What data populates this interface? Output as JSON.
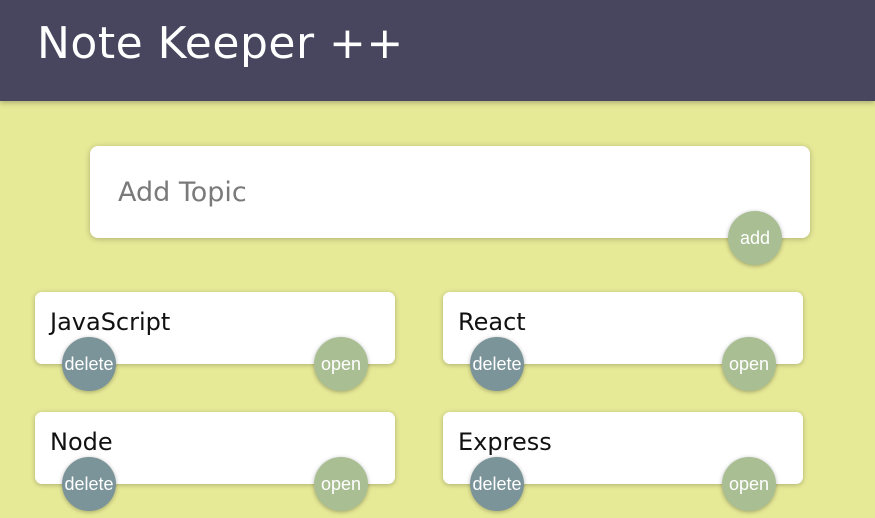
{
  "header": {
    "title": "Note Keeper ++"
  },
  "add_topic": {
    "placeholder": "Add Topic",
    "value": "",
    "add_label": "add"
  },
  "topics": [
    {
      "name": "JavaScript",
      "delete_label": "delete",
      "open_label": "open"
    },
    {
      "name": "React",
      "delete_label": "delete",
      "open_label": "open"
    },
    {
      "name": "Node",
      "delete_label": "delete",
      "open_label": "open"
    },
    {
      "name": "Express",
      "delete_label": "delete",
      "open_label": "open"
    }
  ],
  "colors": {
    "background": "#e6e996",
    "header": "#48465e",
    "delete_button": "#7a9499",
    "open_button": "#a9bf93",
    "card": "#ffffff"
  }
}
